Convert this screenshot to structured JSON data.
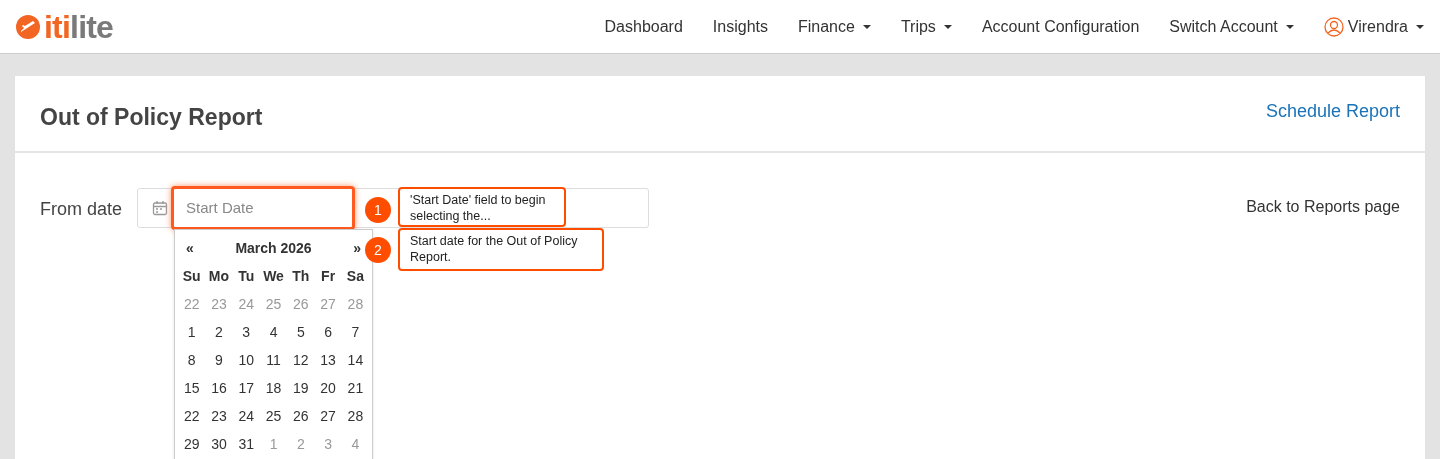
{
  "logo": {
    "accent": "iti",
    "rest": "lite"
  },
  "nav": [
    {
      "label": "Dashboard",
      "dropdown": false
    },
    {
      "label": "Insights",
      "dropdown": false
    },
    {
      "label": "Finance",
      "dropdown": true
    },
    {
      "label": "Trips",
      "dropdown": true
    },
    {
      "label": "Account Configuration",
      "dropdown": false
    },
    {
      "label": "Switch Account",
      "dropdown": true
    }
  ],
  "user": {
    "name": "Virendra",
    "dropdown": true
  },
  "page": {
    "title": "Out of Policy Report",
    "schedule_link": "Schedule Report",
    "back_link": "Back to Reports page"
  },
  "filter": {
    "label": "From date",
    "start_placeholder": "Start Date"
  },
  "calendar": {
    "prev": "«",
    "month": "March 2026",
    "next": "»",
    "weekdays": [
      "Su",
      "Mo",
      "Tu",
      "We",
      "Th",
      "Fr",
      "Sa"
    ],
    "weeks": [
      [
        {
          "day": "22",
          "muted": true
        },
        {
          "day": "23",
          "muted": true
        },
        {
          "day": "24",
          "muted": true
        },
        {
          "day": "25",
          "muted": true
        },
        {
          "day": "26",
          "muted": true
        },
        {
          "day": "27",
          "muted": true
        },
        {
          "day": "28",
          "muted": true
        }
      ],
      [
        {
          "day": "1",
          "muted": false
        },
        {
          "day": "2",
          "muted": false
        },
        {
          "day": "3",
          "muted": false
        },
        {
          "day": "4",
          "muted": false
        },
        {
          "day": "5",
          "muted": false
        },
        {
          "day": "6",
          "muted": false
        },
        {
          "day": "7",
          "muted": false
        }
      ],
      [
        {
          "day": "8",
          "muted": false
        },
        {
          "day": "9",
          "muted": false
        },
        {
          "day": "10",
          "muted": false
        },
        {
          "day": "11",
          "muted": false
        },
        {
          "day": "12",
          "muted": false
        },
        {
          "day": "13",
          "muted": false
        },
        {
          "day": "14",
          "muted": false
        }
      ],
      [
        {
          "day": "15",
          "muted": false
        },
        {
          "day": "16",
          "muted": false
        },
        {
          "day": "17",
          "muted": false
        },
        {
          "day": "18",
          "muted": false
        },
        {
          "day": "19",
          "muted": false
        },
        {
          "day": "20",
          "muted": false
        },
        {
          "day": "21",
          "muted": false
        }
      ],
      [
        {
          "day": "22",
          "muted": false
        },
        {
          "day": "23",
          "muted": false
        },
        {
          "day": "24",
          "muted": false
        },
        {
          "day": "25",
          "muted": false
        },
        {
          "day": "26",
          "muted": false
        },
        {
          "day": "27",
          "muted": false
        },
        {
          "day": "28",
          "muted": false
        }
      ],
      [
        {
          "day": "29",
          "muted": false
        },
        {
          "day": "30",
          "muted": false
        },
        {
          "day": "31",
          "muted": false
        },
        {
          "day": "1",
          "muted": true
        },
        {
          "day": "2",
          "muted": true
        },
        {
          "day": "3",
          "muted": true
        },
        {
          "day": "4",
          "muted": true
        }
      ]
    ]
  },
  "annotations": [
    {
      "number": "1",
      "text": "'Start Date' field to begin selecting the..."
    },
    {
      "number": "2",
      "text": "Start date for the Out of Policy Report."
    }
  ]
}
